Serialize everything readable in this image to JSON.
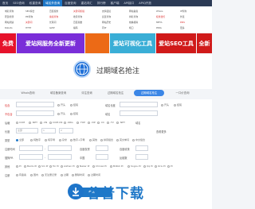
{
  "nav": {
    "items": [
      "首页",
      "SEO查询",
      "权重查询",
      "域名外查询",
      "百度查询",
      "重站词汇",
      "排行榜",
      "客户端",
      "API接口",
      "APIQ开放"
    ],
    "active_index": 3
  },
  "banners": [
    {
      "text": "免费",
      "bg": "#e6122b"
    },
    {
      "text": "爱站网服务全新更新",
      "bg": "#7a2ed8"
    },
    {
      "text": "",
      "bg": "#ec6a16"
    },
    {
      "text": "爱站可视化工具",
      "bg": "#3aaed6"
    },
    {
      "text": "爱站SEO工具",
      "bg": "#d01a1a"
    },
    {
      "text": "全新",
      "bg": "#d01a1a"
    }
  ],
  "hero": {
    "title": "过期域名抢注"
  },
  "tabs": [
    "Whois查询",
    "域名备案查询",
    "评注查询",
    "过期域名抢注",
    "过期域名抢注",
    "一口价查询"
  ],
  "tabs_active": 4,
  "form": {
    "row1": {
      "label": "包含",
      "search_placeholder": "",
      "options": [
        "开头",
        "结尾"
      ],
      "label2": "域名长度",
      "opt_start": "开头",
      "opt_end": "结尾"
    },
    "row2": {
      "label": "不包含",
      "placeholder": "",
      "options": [
        "开头",
        "结尾"
      ],
      "label2": "域名",
      "placeholder2": ""
    },
    "row3": {
      "label": "后缀",
      "options": [
        "COM",
        ".NET",
        ".CN",
        "COM.CN",
        ".ORG",
        ".TOP",
        ".VIP",
        ".CC",
        ".TV",
        ".NET"
      ],
      "label2": "域名"
    },
    "row4": {
      "label": "长度",
      "options": [
        "全部",
        "1",
        "2"
      ],
      "label2": "",
      "more": "查看更多"
    },
    "row5": {
      "label": "类型",
      "options": [
        "全部",
        "纯数字",
        "纯字母",
        "杂米",
        "数字+字母",
        "其他",
        "拼音组合",
        "英文单词",
        "中文组合"
      ]
    },
    "row6": {
      "label": "注册时间",
      "separator": "-",
      "label2": "百度权重",
      "label3": "百度收录"
    },
    "row7": {
      "label": "搜狗PR",
      "separator": "-",
      "label2": "中国",
      "label3": "反链数"
    },
    "row8": {
      "label": "其他",
      "options": [
        "Pr",
        "Baidu Pr",
        "Sm Pr",
        "Tor Pr",
        "Aizhan Pr",
        "Naker Pr",
        "Chinaz Pr",
        "Bilibili Pr",
        "Sogou Pr",
        "Qq Pr",
        "Oris Pr",
        "Pr"
      ]
    },
    "row9": {
      "label": "注册",
      "options": [
        "有备案",
        "国内",
        "无注册记录",
        "过期",
        "删除时间",
        "过期时间"
      ]
    },
    "search_button": "查询"
  },
  "watermark": {
    "text": "谷普下载"
  }
}
